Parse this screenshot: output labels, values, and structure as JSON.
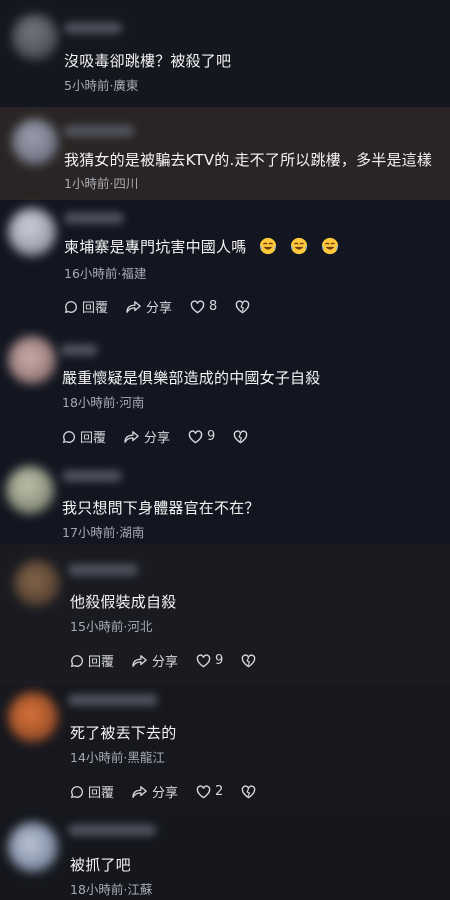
{
  "comments": [
    {
      "text": "沒吸毒卻跳樓？被殺了吧",
      "meta": "5小時前·廣東",
      "show_actions": false
    },
    {
      "text": "我猜女的是被騙去KTV的.走不了所以跳樓，多半是這樣",
      "meta": "1小時前·四川",
      "show_actions": false
    },
    {
      "text": "柬埔寨是專門坑害中國人嗎",
      "emojis": [
        "laughing-crying-emoji",
        "laughing-crying-emoji",
        "laughing-crying-emoji"
      ],
      "meta": "16小時前·福建",
      "show_actions": true,
      "reply_label": "回覆",
      "share_label": "分享",
      "like_count": "8"
    },
    {
      "text": "嚴重懷疑是俱樂部造成的中國女子自殺",
      "meta": "18小時前·河南",
      "show_actions": true,
      "reply_label": "回覆",
      "share_label": "分享",
      "like_count": "9"
    },
    {
      "text": "我只想問下身體器官在不在？",
      "meta": "17小時前·湖南",
      "show_actions": false
    },
    {
      "text": "他殺假裝成自殺",
      "meta": "15小時前·河北",
      "show_actions": true,
      "reply_label": "回覆",
      "share_label": "分享",
      "like_count": "9"
    },
    {
      "text": "死了被丟下去的",
      "meta": "14小時前·黑龍江",
      "show_actions": true,
      "reply_label": "回覆",
      "share_label": "分享",
      "like_count": "2"
    },
    {
      "text": "被抓了吧",
      "meta": "18小時前·江蘇",
      "show_actions": false
    }
  ],
  "colors": {
    "background": "#141722",
    "highlight_row": "#2a2524",
    "text_primary": "#f4f4f4",
    "text_secondary": "#a6a9b2",
    "action_text": "#d6d8de"
  }
}
